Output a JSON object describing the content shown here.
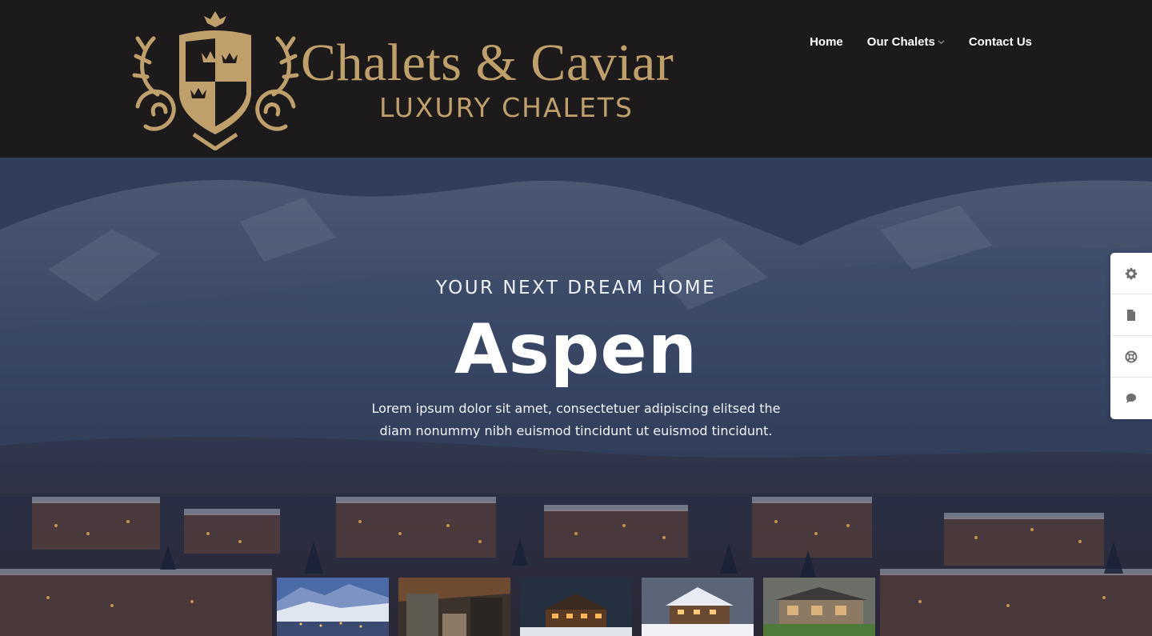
{
  "brand": {
    "title": "Chalets & Caviar",
    "subtitle": "LUXURY CHALETS",
    "color": "#bfa06a"
  },
  "nav": {
    "items": [
      {
        "label": "Home",
        "has_dropdown": false
      },
      {
        "label": "Our Chalets",
        "has_dropdown": true
      },
      {
        "label": "Contact Us",
        "has_dropdown": false
      }
    ]
  },
  "hero": {
    "kicker": "YOUR NEXT DREAM HOME",
    "title": "Aspen",
    "description": "Lorem ipsum dolor sit amet, consectetuer adipiscing elitsed the diam nonummy nibh euismod tincidunt ut euismod tincidunt."
  },
  "thumbnails": [
    {
      "icon": "town-thumbnail"
    },
    {
      "icon": "interior-thumbnail"
    },
    {
      "icon": "chalet-night-thumbnail"
    },
    {
      "icon": "chalet-snow-thumbnail"
    },
    {
      "icon": "modern-house-thumbnail"
    }
  ],
  "side_tools": [
    {
      "icon": "gear-icon"
    },
    {
      "icon": "document-icon"
    },
    {
      "icon": "lifebuoy-icon"
    },
    {
      "icon": "chat-icon"
    }
  ]
}
